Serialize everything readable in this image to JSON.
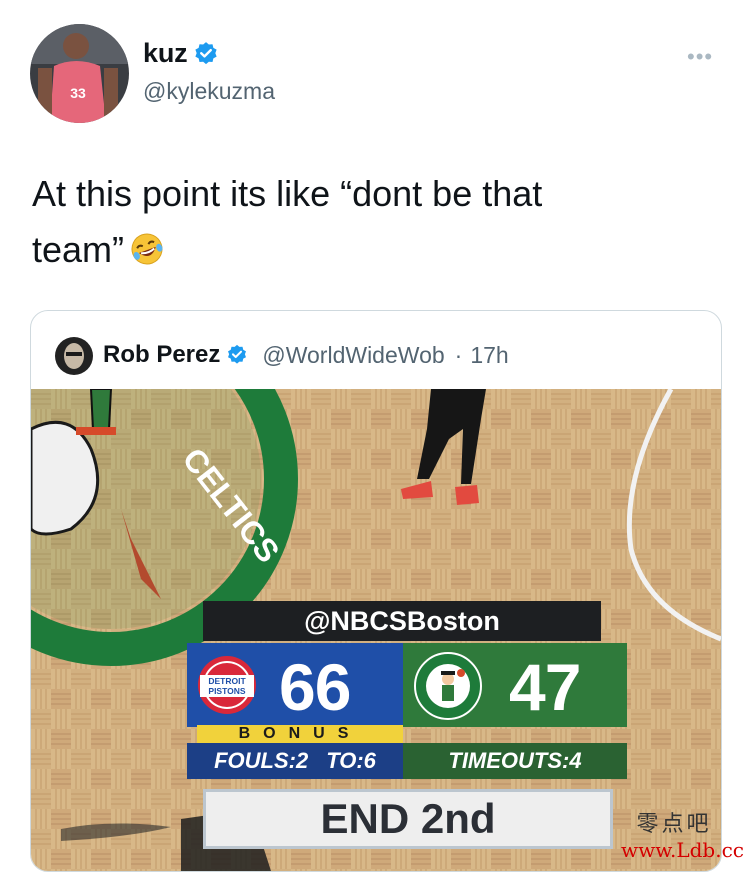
{
  "tweet": {
    "author_name": "kuz",
    "author_handle": "@kylekuzma",
    "more_icon": "ellipsis-icon",
    "jersey_number": "33",
    "text_line1": "At this point its like “dont be that",
    "text_line2": "team”",
    "emoji": "rolling-on-floor-laughing"
  },
  "quote": {
    "author_name": "Rob Perez",
    "author_handle": "@WorldWideWob",
    "separator": "·",
    "time": "17h"
  },
  "scoreboard": {
    "network": "@NBCSBoston",
    "home_team_logo_text": "DETROIT PISTONS",
    "away_logo_text": "BOSTON CELTICS",
    "court_text": "CELTICS",
    "pistons_score": "66",
    "celtics_score": "47",
    "bonus": "BONUS",
    "fouls": "FOULS:2",
    "to": "TO:6",
    "timeouts": "TIMEOUTS:4",
    "period": "END 2nd"
  },
  "watermark": {
    "chinese": "零点吧",
    "url": "www.Ldb.cc"
  },
  "colors": {
    "verified_blue": "#1d9bf0",
    "pistons_blue": "#1f4fa8",
    "celtics_green": "#2f7a3b",
    "bonus_yellow": "#f1d23b",
    "court_wood": "#d8b888"
  }
}
